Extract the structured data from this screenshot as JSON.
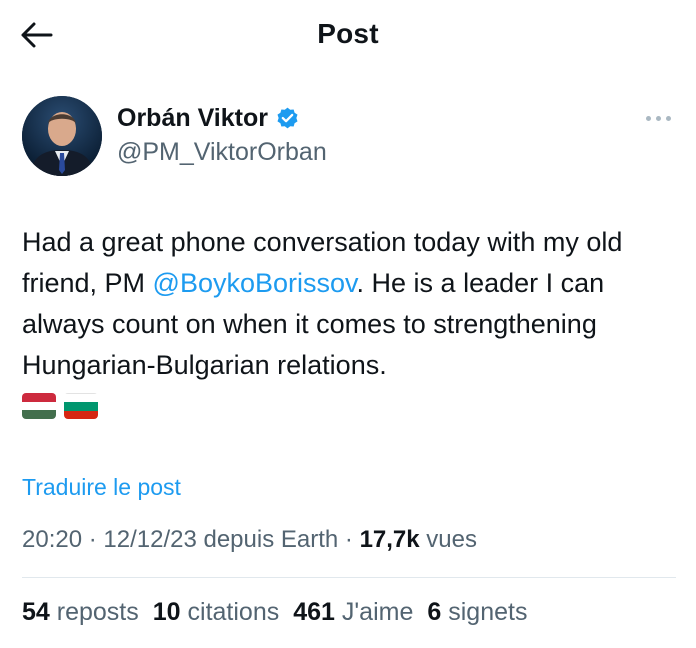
{
  "header": {
    "title": "Post",
    "back_icon": "arrow-left-icon"
  },
  "author": {
    "display_name": "Orbán Viktor",
    "handle": "@PM_ViktorOrban",
    "verified_color": "#1d9bf0"
  },
  "post": {
    "text_before": "Had a great phone conversation today with my old friend, PM ",
    "mention": "@BoykoBorissov",
    "text_after": ". He is a leader I can always count on when it comes to strengthening Hungarian-Bulgarian relations.",
    "flags": [
      "hungary-flag-icon",
      "bulgaria-flag-icon"
    ],
    "translate_label": "Traduire le post"
  },
  "meta": {
    "time": "20:20",
    "separator": " · ",
    "date": "12/12/23",
    "source": " depuis Earth",
    "views_count": "17,7k",
    "views_label": " vues"
  },
  "stats": {
    "reposts_count": "54",
    "reposts_label": "reposts",
    "quotes_count": "10",
    "quotes_label": "citations",
    "likes_count": "461",
    "likes_label": "J'aime",
    "bookmarks_count": "6",
    "bookmarks_label": "signets"
  },
  "colors": {
    "accent": "#1d9bf0",
    "muted": "#536471",
    "text": "#0f1419"
  }
}
